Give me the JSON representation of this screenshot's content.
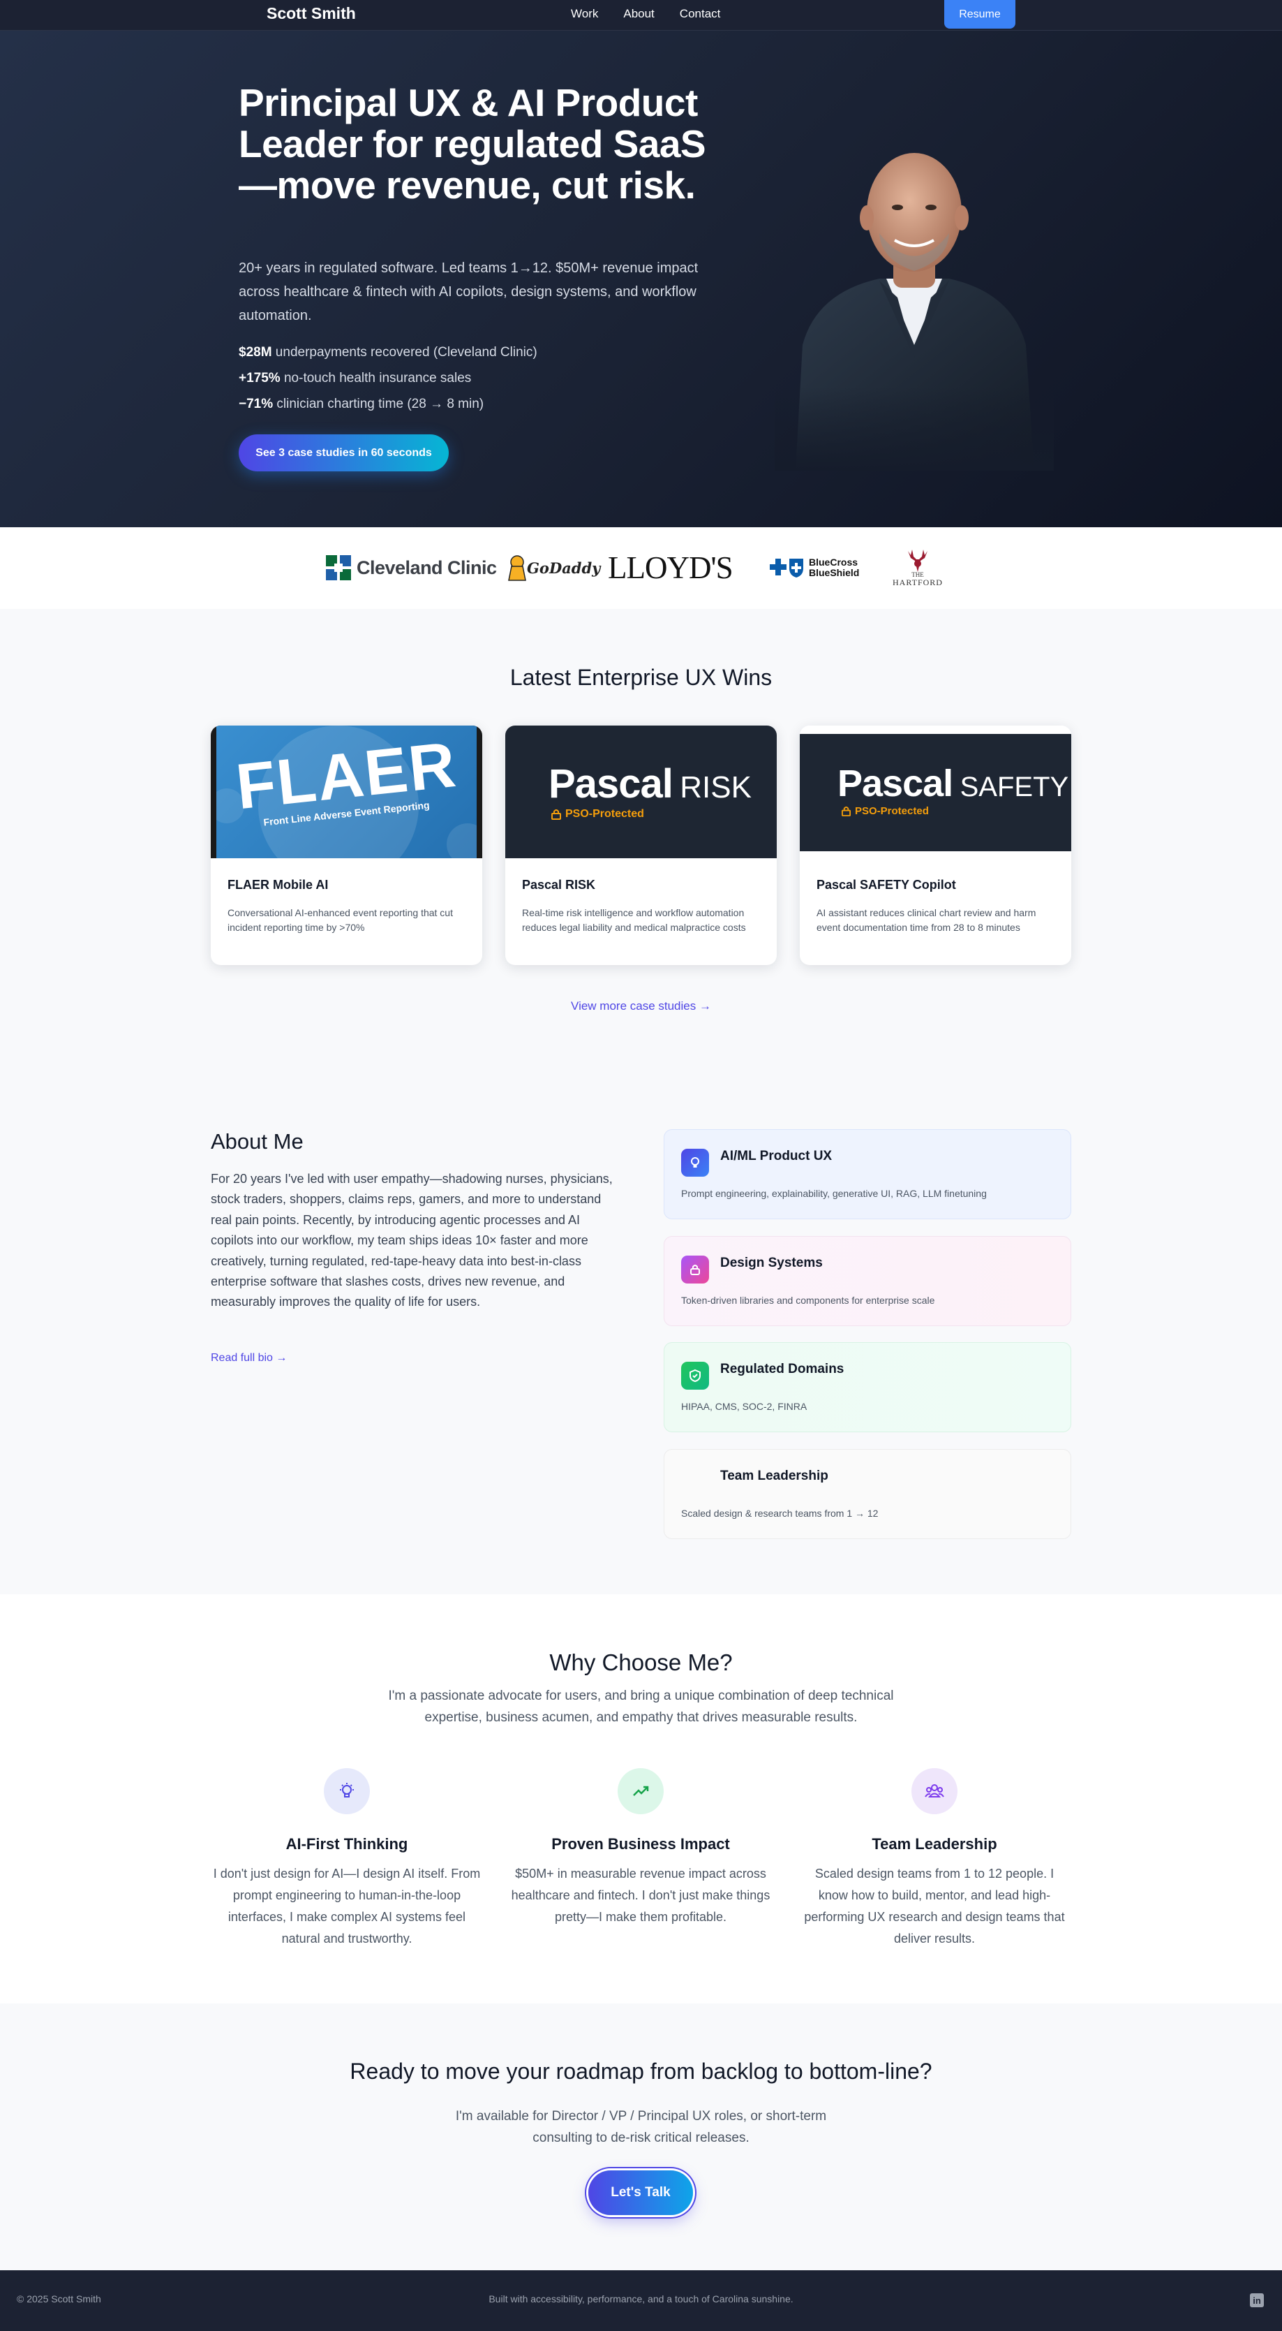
{
  "nav": {
    "brand": "Scott Smith",
    "links": [
      "Work",
      "About",
      "Contact"
    ],
    "resume": "Resume"
  },
  "hero": {
    "headline": "Principal UX & AI Product Leader for regulated SaaS—move revenue, cut risk.",
    "subtitle": "20+ years in regulated software. Led teams 1→12. $50M+ revenue impact across healthcare & fintech with AI copilots, design systems, and workflow automation.",
    "stats": [
      {
        "value": "$28M",
        "text": " underpayments recovered (Cleveland Clinic)"
      },
      {
        "value": "+175%",
        "text": " no-touch health insurance sales"
      },
      {
        "value": "−71%",
        "text": " clinician charting time (28 → 8 min)"
      }
    ],
    "cta": "See 3 case studies in 60 seconds"
  },
  "logos": {
    "cleveland": "Cleveland Clinic",
    "godaddy": "GoDaddy",
    "lloyds": "LLOYD'S",
    "bcbs_line1": "BlueCross",
    "bcbs_line2": "BlueShield",
    "hartford_line1": "THE",
    "hartford_line2": "HARTFORD"
  },
  "wins": {
    "title": "Latest Enterprise UX Wins",
    "cards": [
      {
        "thumb_title": "FLAER",
        "thumb_sub": "Front Line Adverse Event Reporting",
        "title": "FLAER Mobile AI",
        "desc": "Conversational AI-enhanced event reporting that cut incident reporting time by >70%"
      },
      {
        "thumb_title": "Pascal",
        "thumb_suffix": "RISK",
        "thumb_badge": "PSO-Protected",
        "title": "Pascal RISK",
        "desc": "Real-time risk intelligence and workflow automation reduces legal liability and medical malpractice costs"
      },
      {
        "thumb_title": "Pascal",
        "thumb_suffix": "SAFETY",
        "thumb_badge": "PSO-Protected",
        "title": "Pascal SAFETY Copilot",
        "desc": "AI assistant reduces clinical chart review and harm event documentation time from 28 to 8 minutes"
      }
    ],
    "more": "View more case studies  →"
  },
  "about": {
    "title": "About Me",
    "text": "For 20 years I've led with user empathy—shadowing nurses, physicians, stock traders, shoppers, claims reps, gamers, and more to understand real pain points. Recently, by introducing agentic processes and AI copilots into our workflow, my team ships ideas 10× faster and more creatively, turning regulated, red-tape-heavy data into best-in-class enterprise software that slashes costs, drives new revenue, and measurably improves the quality of life for users.",
    "link": "Read full bio →",
    "skills": [
      {
        "title": "AI/ML Product UX",
        "desc": "Prompt engineering, explainability, generative UI, RAG, LLM finetuning",
        "icon": "lightbulb-icon"
      },
      {
        "title": "Design Systems",
        "desc": "Token-driven libraries and components for enterprise scale",
        "icon": "lock-icon"
      },
      {
        "title": "Regulated Domains",
        "desc": "HIPAA, CMS, SOC-2, FINRA",
        "icon": "shield-icon"
      },
      {
        "title": "Team Leadership",
        "desc": "Scaled design & research teams from 1 → 12",
        "icon": "team-icon"
      }
    ]
  },
  "why": {
    "title": "Why Choose Me?",
    "subtitle": "I'm a passionate advocate for users, and bring a unique combination of deep technical expertise, business acumen, and empathy that drives measurable results.",
    "features": [
      {
        "title": "AI-First Thinking",
        "desc": "I don't just design for AI—I design AI itself. From prompt engineering to human-in-the-loop interfaces, I make complex AI systems feel natural and trustworthy.",
        "icon": "lightbulb-icon"
      },
      {
        "title": "Proven Business Impact",
        "desc": "$50M+ in measurable revenue impact across healthcare and fintech. I don't just make things pretty—I make them profitable.",
        "icon": "trending-up-icon"
      },
      {
        "title": "Team Leadership",
        "desc": "Scaled design teams from 1 to 12 people. I know how to build, mentor, and lead high-performing UX research and design teams that deliver results.",
        "icon": "team-icon"
      }
    ]
  },
  "cta": {
    "title": "Ready to move your roadmap from backlog to bottom-line?",
    "subtitle": "I'm available for Director / VP / Principal UX roles, or short-term consulting to de-risk critical releases.",
    "button": "Let's Talk"
  },
  "footer": {
    "copyright": "© 2025 Scott Smith",
    "built": "Built with accessibility, performance, and a touch of Carolina sunshine.",
    "linkedin_icon": "linkedin-icon"
  },
  "colors": {
    "accent": "#4f46e5",
    "resume": "#3b82f6",
    "nav_bg": "#1c2233",
    "hero_bg": "#1b2335"
  }
}
